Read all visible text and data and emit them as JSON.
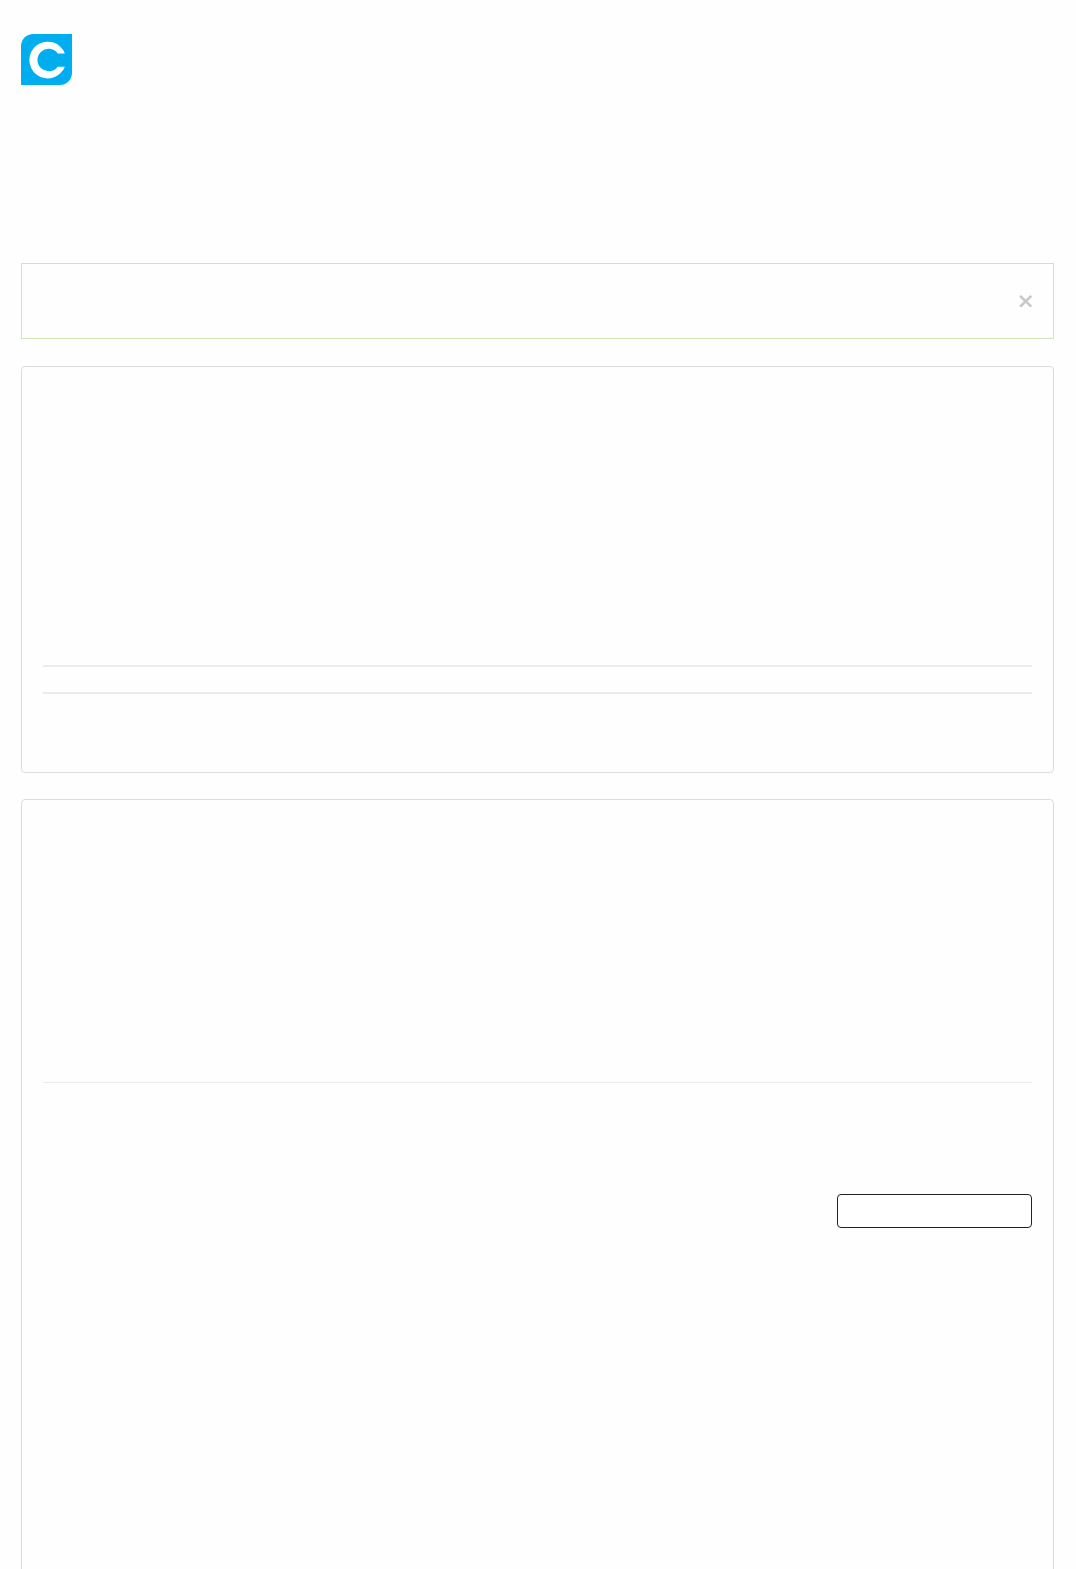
{
  "alert": {
    "close": "×"
  }
}
